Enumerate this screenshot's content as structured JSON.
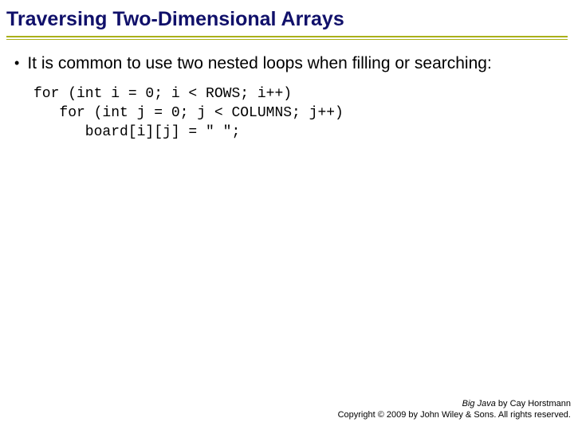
{
  "title": "Traversing Two-Dimensional Arrays",
  "bullet": "It is common to use two nested loops when filling or searching:",
  "code": {
    "line1": "for (int i = 0; i < ROWS; i++)",
    "line2": "   for (int j = 0; j < COLUMNS; j++)",
    "line3": "      board[i][j] = \" \";"
  },
  "footer": {
    "book": "Big Java",
    "author": " by Cay Horstmann",
    "copyright": "Copyright © 2009 by John Wiley & Sons.  All rights reserved."
  }
}
